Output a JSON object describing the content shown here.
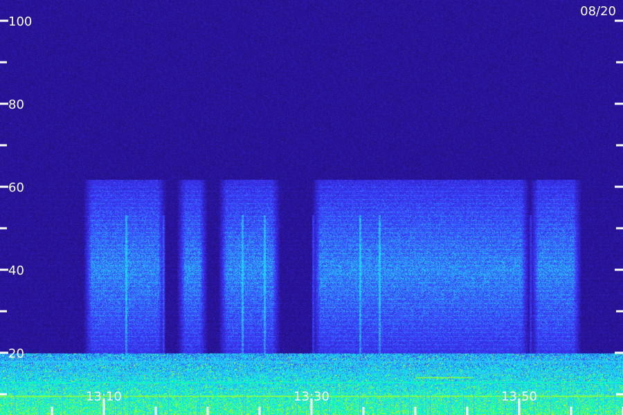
{
  "chart_data": {
    "type": "heatmap",
    "date_label": "08/20",
    "y_range": [
      0,
      100
    ],
    "y_ticks": [
      {
        "value": 100,
        "label": "100"
      },
      {
        "value": 80,
        "label": "80"
      },
      {
        "value": 60,
        "label": "60"
      },
      {
        "value": 40,
        "label": "40"
      },
      {
        "value": 20,
        "label": "20"
      }
    ],
    "y_minor_ticks": [
      90,
      70,
      50,
      30,
      10
    ],
    "x_range": [
      "13:00",
      "14:05"
    ],
    "x_ticks": [
      {
        "value": "13:10",
        "label": "13:10"
      },
      {
        "value": "13:30",
        "label": "13:30"
      },
      {
        "value": "13:50",
        "label": "13:50"
      }
    ],
    "x_minor_ticks": [
      "13:05",
      "13:15",
      "13:20",
      "13:25",
      "13:35",
      "13:40",
      "13:45",
      "13:55",
      "14:00"
    ],
    "background_color": "#260f60",
    "axis_color": "#ffffff",
    "colormap": [
      "#1a0a50",
      "#2a14a0",
      "#3c3cff",
      "#28c8ff",
      "#00ffc8",
      "#c8ff00"
    ],
    "energy_band": [
      20,
      60
    ],
    "active_intervals": [
      [
        "13:08",
        "13:16"
      ],
      [
        "13:17",
        "13:20"
      ],
      [
        "13:21",
        "13:27"
      ],
      [
        "13:30",
        "13:51"
      ],
      [
        "13:51",
        "13:56"
      ]
    ]
  }
}
